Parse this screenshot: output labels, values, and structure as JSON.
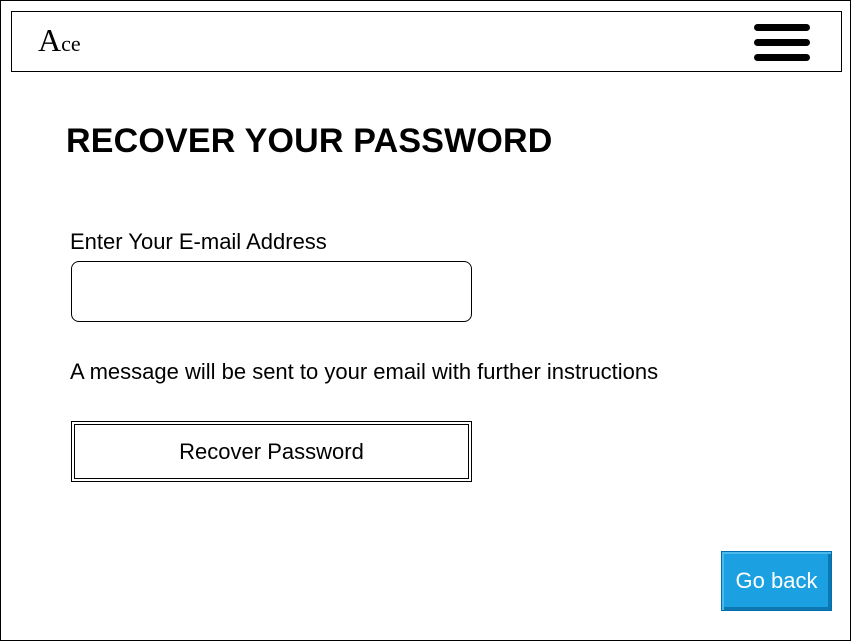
{
  "header": {
    "logo_initial": "A",
    "logo_rest": "ce",
    "menu_icon": "hamburger-menu-icon"
  },
  "main": {
    "title": "RECOVER YOUR PASSWORD",
    "email_label": "Enter Your E-mail Address",
    "email_value": "",
    "email_placeholder": "",
    "info_message": "A message will be sent to your email with further instructions",
    "recover_button_label": "Recover Password"
  },
  "footer": {
    "go_back_label": "Go back"
  },
  "colors": {
    "accent": "#1ba1e2",
    "text": "#000000",
    "background": "#ffffff"
  }
}
